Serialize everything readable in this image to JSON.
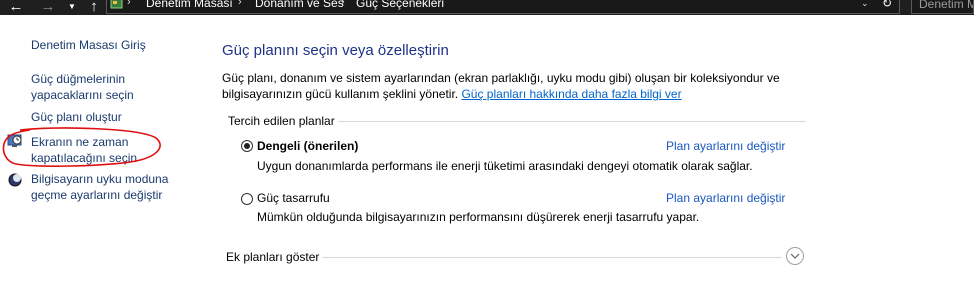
{
  "address_bar": {
    "breadcrumbs": [
      "Denetim Masası",
      "Donanım ve Ses",
      "Güç Seçenekleri"
    ],
    "search_placeholder": "Denetim M"
  },
  "sidebar": {
    "home_link": "Denetim Masası Giriş",
    "links": [
      {
        "line1": "Güç düğmelerinin",
        "line2": "yapacaklarını seçin"
      },
      {
        "line1": "Güç planı oluştur"
      },
      {
        "line1": "Ekranın ne zaman",
        "line2": "kapatılacağını seçin"
      },
      {
        "line1": "Bilgisayarın uyku moduna",
        "line2": "geçme ayarlarını değiştir"
      }
    ]
  },
  "main": {
    "title": "Güç planını seçin veya özelleştirin",
    "desc_line1": "Güç planı, donanım ve sistem ayarlarından (ekran parlaklığı, uyku modu gibi) oluşan bir koleksiyondur ve",
    "desc_line2": "bilgisayarınızın gücü kullanım şeklini yönetir.",
    "desc_link": "Güç planları hakkında daha fazla bilgi ver",
    "group_label": "Tercih edilen planlar",
    "plans": [
      {
        "name": "Dengeli (önerilen)",
        "description": "Uygun donanımlarda performans ile enerji tüketimi arasındaki dengeyi otomatik olarak sağlar.",
        "link": "Plan ayarlarını değiştir",
        "selected": true
      },
      {
        "name": "Güç tasarrufu",
        "description": "Mümkün olduğunda bilgisayarınızın performansını düşürerek enerji tasarrufu yapar.",
        "link": "Plan ayarlarını değiştir",
        "selected": false
      }
    ],
    "more_plans_label": "Ek planları göster"
  },
  "colors": {
    "title": "#1e3287",
    "link": "#1a58c0",
    "sidebar_link": "#1a3a6e",
    "annotation": "#e01010",
    "address_bar_bg": "#1f1f1f"
  }
}
